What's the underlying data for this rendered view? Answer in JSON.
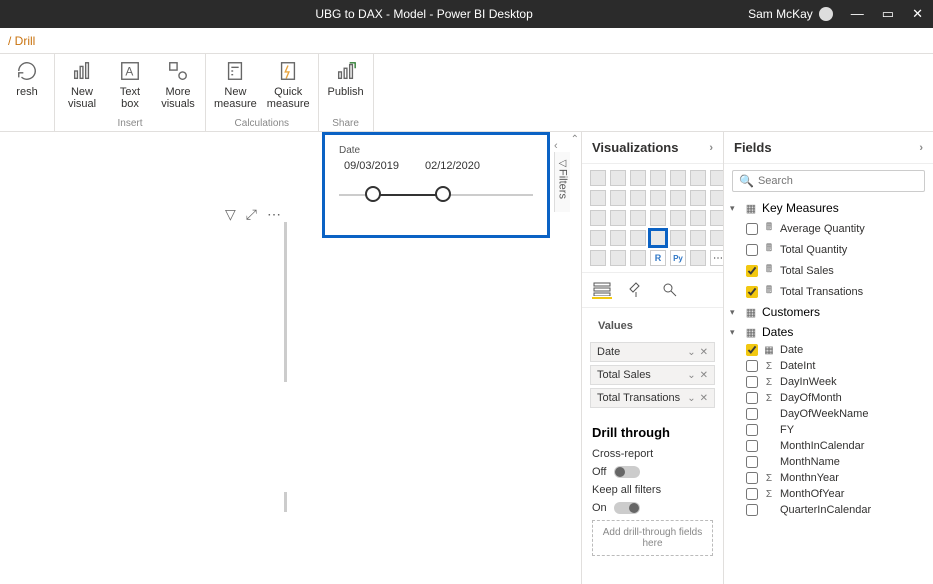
{
  "titlebar": {
    "title": "UBG to DAX - Model - Power BI Desktop",
    "user": "Sam McKay"
  },
  "breadcrumb": "/ Drill",
  "ribbon": {
    "refresh": "resh",
    "new_visual": "New\nvisual",
    "text_box": "Text\nbox",
    "more_visuals": "More\nvisuals",
    "new_measure": "New\nmeasure",
    "quick_measure": "Quick\nmeasure",
    "publish": "Publish",
    "groups": {
      "insert": "Insert",
      "calculations": "Calculations",
      "share": "Share"
    }
  },
  "slicer": {
    "label": "Date",
    "start": "09/03/2019",
    "end": "02/12/2020"
  },
  "filters_tab": "Filters",
  "panes": {
    "visualizations": "Visualizations",
    "fields": "Fields"
  },
  "values": {
    "label": "Values",
    "items": [
      "Date",
      "Total Sales",
      "Total Transations"
    ]
  },
  "drill": {
    "heading": "Drill through",
    "cross_report": "Cross-report",
    "off": "Off",
    "keep_filters": "Keep all filters",
    "on": "On",
    "placeholder": "Add drill-through fields here"
  },
  "search": {
    "placeholder": "Search"
  },
  "field_tables": {
    "key_measures": {
      "name": "Key Measures",
      "fields": [
        {
          "name": "Average Quantity",
          "checked": false,
          "icon": "calc"
        },
        {
          "name": "Total Quantity",
          "checked": false,
          "icon": "calc"
        },
        {
          "name": "Total Sales",
          "checked": true,
          "icon": "calc"
        },
        {
          "name": "Total Transations",
          "checked": true,
          "icon": "calc"
        }
      ]
    },
    "customers": {
      "name": "Customers"
    },
    "dates": {
      "name": "Dates",
      "fields": [
        {
          "name": "Date",
          "checked": true,
          "icon": "cal"
        },
        {
          "name": "DateInt",
          "checked": false,
          "icon": "sigma"
        },
        {
          "name": "DayInWeek",
          "checked": false,
          "icon": "sigma"
        },
        {
          "name": "DayOfMonth",
          "checked": false,
          "icon": "sigma"
        },
        {
          "name": "DayOfWeekName",
          "checked": false,
          "icon": ""
        },
        {
          "name": "FY",
          "checked": false,
          "icon": ""
        },
        {
          "name": "MonthInCalendar",
          "checked": false,
          "icon": ""
        },
        {
          "name": "MonthName",
          "checked": false,
          "icon": ""
        },
        {
          "name": "MonthnYear",
          "checked": false,
          "icon": "sigma"
        },
        {
          "name": "MonthOfYear",
          "checked": false,
          "icon": "sigma"
        },
        {
          "name": "QuarterInCalendar",
          "checked": false,
          "icon": ""
        }
      ]
    }
  }
}
